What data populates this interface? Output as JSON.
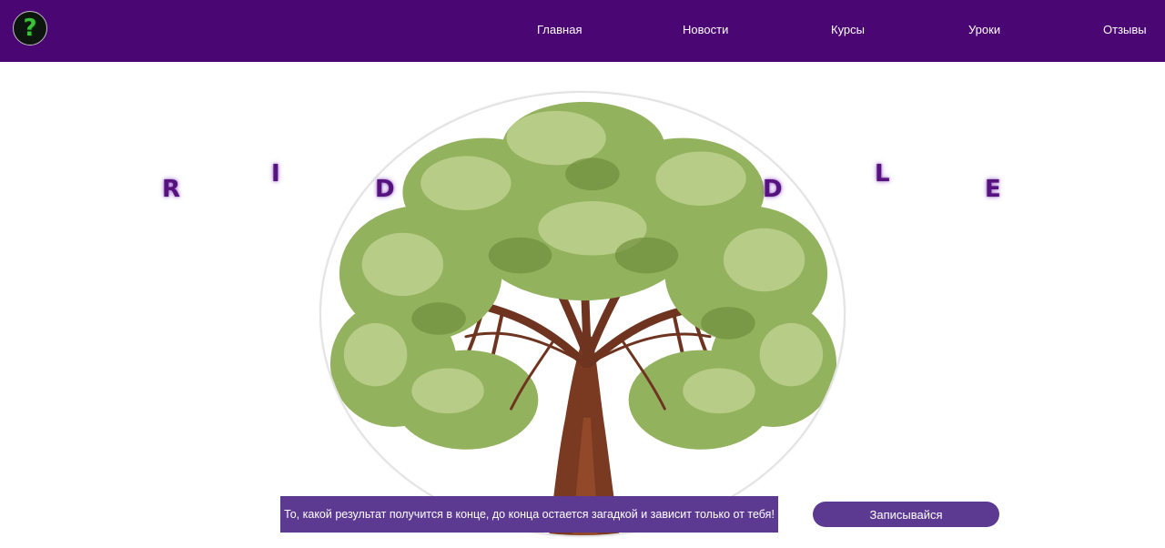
{
  "header": {
    "logo_icon": "question-mark-icon",
    "logo_glyph": "?",
    "nav": [
      {
        "label": "Главная"
      },
      {
        "label": "Новости"
      },
      {
        "label": "Курсы"
      },
      {
        "label": "Уроки"
      },
      {
        "label": "Отзывы"
      }
    ]
  },
  "hero": {
    "letters": [
      "R",
      "I",
      "D",
      "D",
      "L",
      "E"
    ],
    "image_icon": "tree-illustration",
    "tagline": "То, какой результат получится в конце, до конца остается загадкой и зависит только от тебя!",
    "cta_label": "Записывайся"
  },
  "colors": {
    "header_bg": "#4a0673",
    "accent": "#5d3a92",
    "letters": "#56127f",
    "foliage": "#8fae5a",
    "trunk": "#7a3a22"
  }
}
